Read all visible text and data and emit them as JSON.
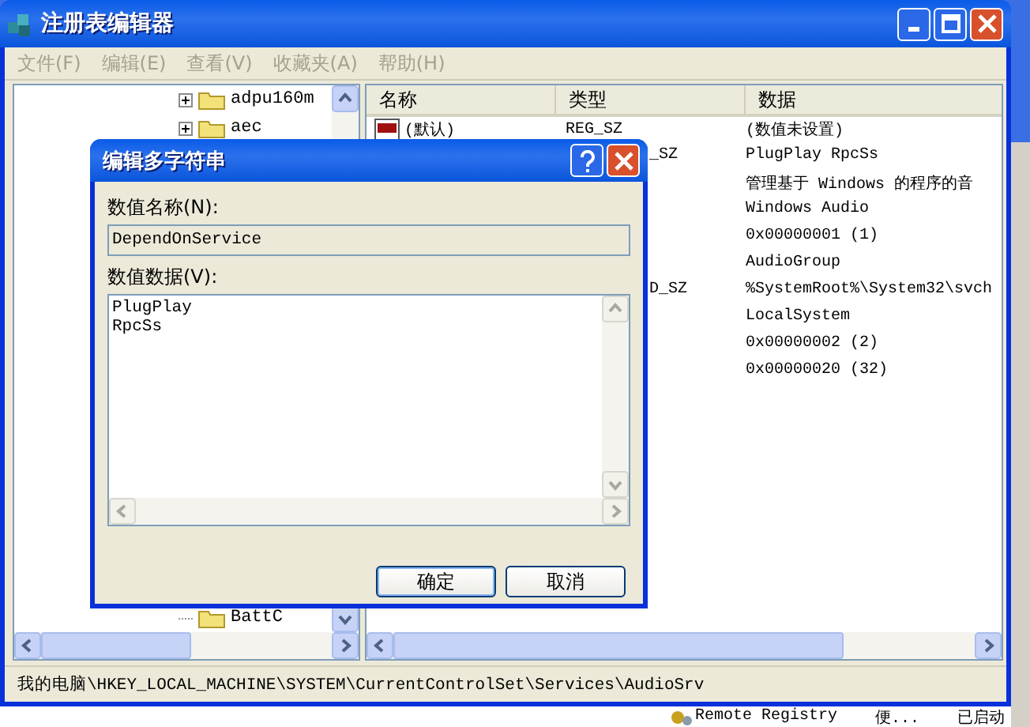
{
  "window": {
    "title": "注册表编辑器"
  },
  "menu": [
    {
      "label": "文件(F)",
      "disabled": true
    },
    {
      "label": "编辑(E)",
      "disabled": true
    },
    {
      "label": "查看(V)",
      "disabled": true
    },
    {
      "label": "收藏夹(A)",
      "disabled": true
    },
    {
      "label": "帮助(H)",
      "disabled": true
    }
  ],
  "tree": {
    "items": [
      {
        "label": "adpu160m",
        "has_children": true
      },
      {
        "label": "aec",
        "has_children": true
      },
      {
        "label": "BattC",
        "has_children": false
      }
    ]
  },
  "list": {
    "columns": [
      "名称",
      "类型",
      "数据"
    ],
    "rows": [
      {
        "name": "(默认)",
        "type": "REG_SZ",
        "data": "(数值未设置)"
      },
      {
        "type": "_SZ",
        "data": "PlugPlay RpcSs"
      },
      {
        "data": "管理基于 Windows 的程序的音"
      },
      {
        "data": "Windows Audio"
      },
      {
        "data": "0x00000001 (1)"
      },
      {
        "data": "AudioGroup"
      },
      {
        "type": "D_SZ",
        "data": "%SystemRoot%\\System32\\svch"
      },
      {
        "data": "LocalSystem"
      },
      {
        "data": "0x00000002 (2)"
      },
      {
        "data": "0x00000020 (32)"
      }
    ]
  },
  "status_bar": "我的电脑\\HKEY_LOCAL_MACHINE\\SYSTEM\\CurrentControlSet\\Services\\AudioSrv",
  "dialog": {
    "title": "编辑多字符串",
    "name_label": "数值名称(N):",
    "name_value": "DependOnService",
    "data_label": "数值数据(V):",
    "data_lines": [
      "PlugPlay",
      "RpcSs"
    ],
    "buttons": [
      "确定",
      "取消"
    ]
  },
  "background_window": {
    "name": "Remote Registry",
    "column_2": "便...",
    "column_3": "已启动"
  }
}
